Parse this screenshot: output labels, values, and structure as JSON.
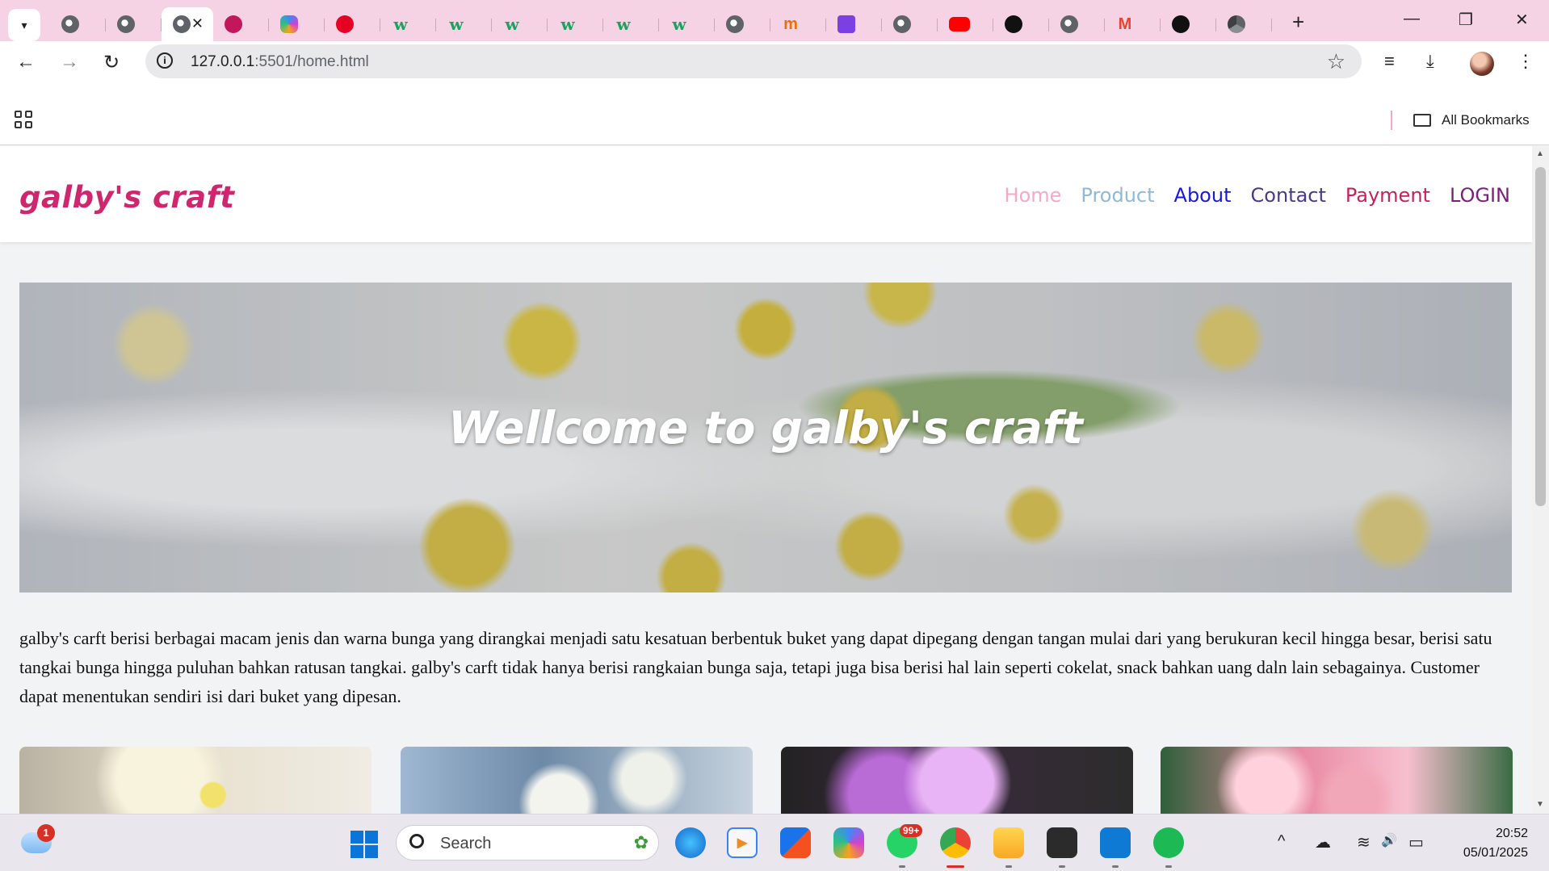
{
  "browser": {
    "tabs": [
      {
        "icon": "globe-icon"
      },
      {
        "icon": "globe-icon"
      },
      {
        "icon": "active-page-icon",
        "active": true,
        "close": "✕"
      },
      {
        "icon": "lips-icon"
      },
      {
        "icon": "copilot-icon"
      },
      {
        "icon": "pinterest-icon"
      },
      {
        "icon": "w3schools-icon",
        "letter": "w"
      },
      {
        "icon": "w3schools-icon",
        "letter": "w"
      },
      {
        "icon": "w3schools-icon",
        "letter": "w"
      },
      {
        "icon": "w3schools-icon",
        "letter": "w"
      },
      {
        "icon": "w3schools-icon",
        "letter": "w"
      },
      {
        "icon": "w3schools-icon",
        "letter": "w"
      },
      {
        "icon": "globe-icon"
      },
      {
        "icon": "m-icon",
        "letter": "m"
      },
      {
        "icon": "h-icon"
      },
      {
        "icon": "globe-icon"
      },
      {
        "icon": "youtube-icon"
      },
      {
        "icon": "github-icon"
      },
      {
        "icon": "globe-icon"
      },
      {
        "icon": "gmail-icon",
        "letter": "M"
      },
      {
        "icon": "github-icon"
      },
      {
        "icon": "chrome-icon"
      }
    ],
    "new_tab": "+",
    "window_controls": {
      "minimize": "—",
      "restore": "❐",
      "close": "✕"
    },
    "address": {
      "host": "127.0.0.1",
      "rest": ":5501/home.html"
    },
    "nav": {
      "back": "←",
      "forward": "→",
      "reload": "↻"
    },
    "toolbar_icons": {
      "star": "☆",
      "media": "≡",
      "download": "⤓",
      "menu": "⋮"
    },
    "bookmarks": {
      "all_label": "All Bookmarks"
    }
  },
  "site": {
    "logo": "galby's craft",
    "nav": [
      {
        "label": "Home",
        "color": "#f4a9c6"
      },
      {
        "label": "Product",
        "color": "#8fb9d8"
      },
      {
        "label": "About",
        "color": "#1a1ad6"
      },
      {
        "label": "Contact",
        "color": "#4b3a86"
      },
      {
        "label": "Payment",
        "color": "#c5215a"
      },
      {
        "label": "LOGIN",
        "color": "#7a1f7a"
      }
    ],
    "hero_title": "Wellcome to galby's craft",
    "intro": "galby's carft berisi berbagai macam jenis dan warna bunga yang dirangkai menjadi satu kesatuan berbentuk buket yang dapat dipegang dengan tangan mulai dari yang berukuran kecil hingga besar, berisi satu tangkai bunga hingga puluhan bahkan ratusan tangkai. galby's carft tidak hanya berisi rangkaian bunga saja, tetapi juga bisa berisi hal lain seperti cokelat, snack bahkan uang daln lain sebagainya. Customer dapat menentukan sendiri isi dari buket yang dipesan."
  },
  "taskbar": {
    "weather_badge": "1",
    "search_placeholder": "Search",
    "whatsapp_badge": "99+",
    "time": "20:52",
    "date": "05/01/2025",
    "tray": {
      "chevron": "^",
      "cloud": "☁",
      "wifi": "≋",
      "volume": "🔊",
      "battery": "▭"
    }
  }
}
